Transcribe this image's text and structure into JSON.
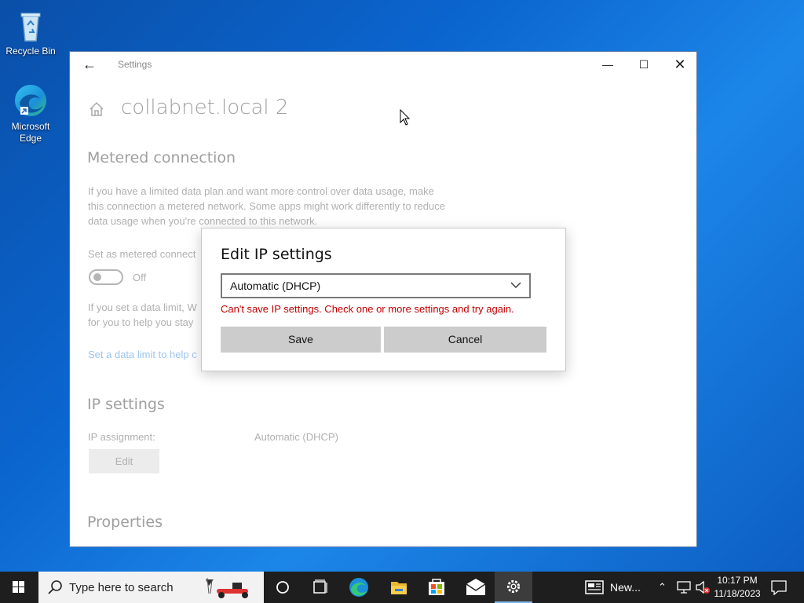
{
  "desktop": {
    "icons": [
      {
        "label": "Recycle Bin",
        "icon": "recycle-bin-icon"
      },
      {
        "label": "Microsoft Edge",
        "icon": "edge-icon"
      }
    ]
  },
  "window": {
    "title": "Settings",
    "page_title": "collabnet.local 2",
    "metered": {
      "heading": "Metered connection",
      "description": "If you have a limited data plan and want more control over data usage, make this connection a metered network. Some apps might work differently to reduce data usage when you're connected to this network.",
      "toggle_label": "Set as metered connect",
      "toggle_state": "Off",
      "limit_text": "If you set a data limit, W\nfor you to help you stay",
      "limit_link": "Set a data limit to help c"
    },
    "ip": {
      "heading": "IP settings",
      "assignment_label": "IP assignment:",
      "assignment_value": "Automatic (DHCP)",
      "edit_label": "Edit"
    },
    "properties_heading": "Properties"
  },
  "dialog": {
    "title": "Edit IP settings",
    "selected": "Automatic (DHCP)",
    "error": "Can't save IP settings. Check one or more settings and try again.",
    "save_label": "Save",
    "cancel_label": "Cancel"
  },
  "taskbar": {
    "search_placeholder": "Type here to search",
    "news_label": "New...",
    "time": "10:17 PM",
    "date": "11/18/2023"
  },
  "colors": {
    "error": "#c40000",
    "accent": "#0078d7",
    "taskbar": "#1e1e1e"
  }
}
